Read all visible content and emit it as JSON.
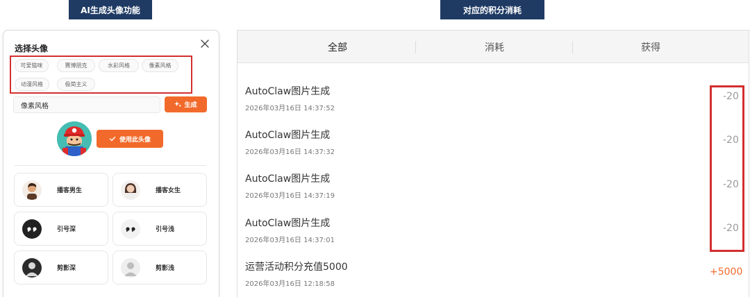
{
  "header": {
    "left_title": "AI生成头像功能",
    "right_title": "对应的积分消耗"
  },
  "avatar_dialog": {
    "title": "选择头像",
    "close_icon": "close-icon",
    "style_tags": [
      "可爱猫咪",
      "赛博朋克",
      "水彩风格",
      "像素风格",
      "动漫风格",
      "极简主义"
    ],
    "prompt_value": "像素风格",
    "generate_label": "生成",
    "use_avatar_label": "使用此头像",
    "voices": [
      {
        "label": "播客男生",
        "icon": "male-avatar-icon"
      },
      {
        "label": "播客女生",
        "icon": "female-avatar-icon"
      },
      {
        "label": "引号深",
        "icon": "quote-dark-icon"
      },
      {
        "label": "引号浅",
        "icon": "quote-light-icon"
      },
      {
        "label": "剪影深",
        "icon": "silhouette-dark-icon"
      },
      {
        "label": "剪影浅",
        "icon": "silhouette-light-icon"
      }
    ],
    "accent_color": "#f26a2b"
  },
  "points_panel": {
    "tabs": [
      "全部",
      "消耗",
      "获得"
    ],
    "records": [
      {
        "title": "AutoClaw图片生成",
        "time": "2026年03月16日 14:37:52",
        "amount": "-20"
      },
      {
        "title": "AutoClaw图片生成",
        "time": "2026年03月16日 14:37:32",
        "amount": "-20"
      },
      {
        "title": "AutoClaw图片生成",
        "time": "2026年03月16日 14:37:19",
        "amount": "-20"
      },
      {
        "title": "AutoClaw图片生成",
        "time": "2026年03月16日 14:37:01",
        "amount": "-20"
      },
      {
        "title": "运营活动积分充值5000",
        "time": "2026年03月16日 12:18:58",
        "amount": "+5000"
      }
    ],
    "negative_color": "#999999",
    "positive_color": "#f26a2b",
    "highlight_color": "#d32f2f"
  }
}
